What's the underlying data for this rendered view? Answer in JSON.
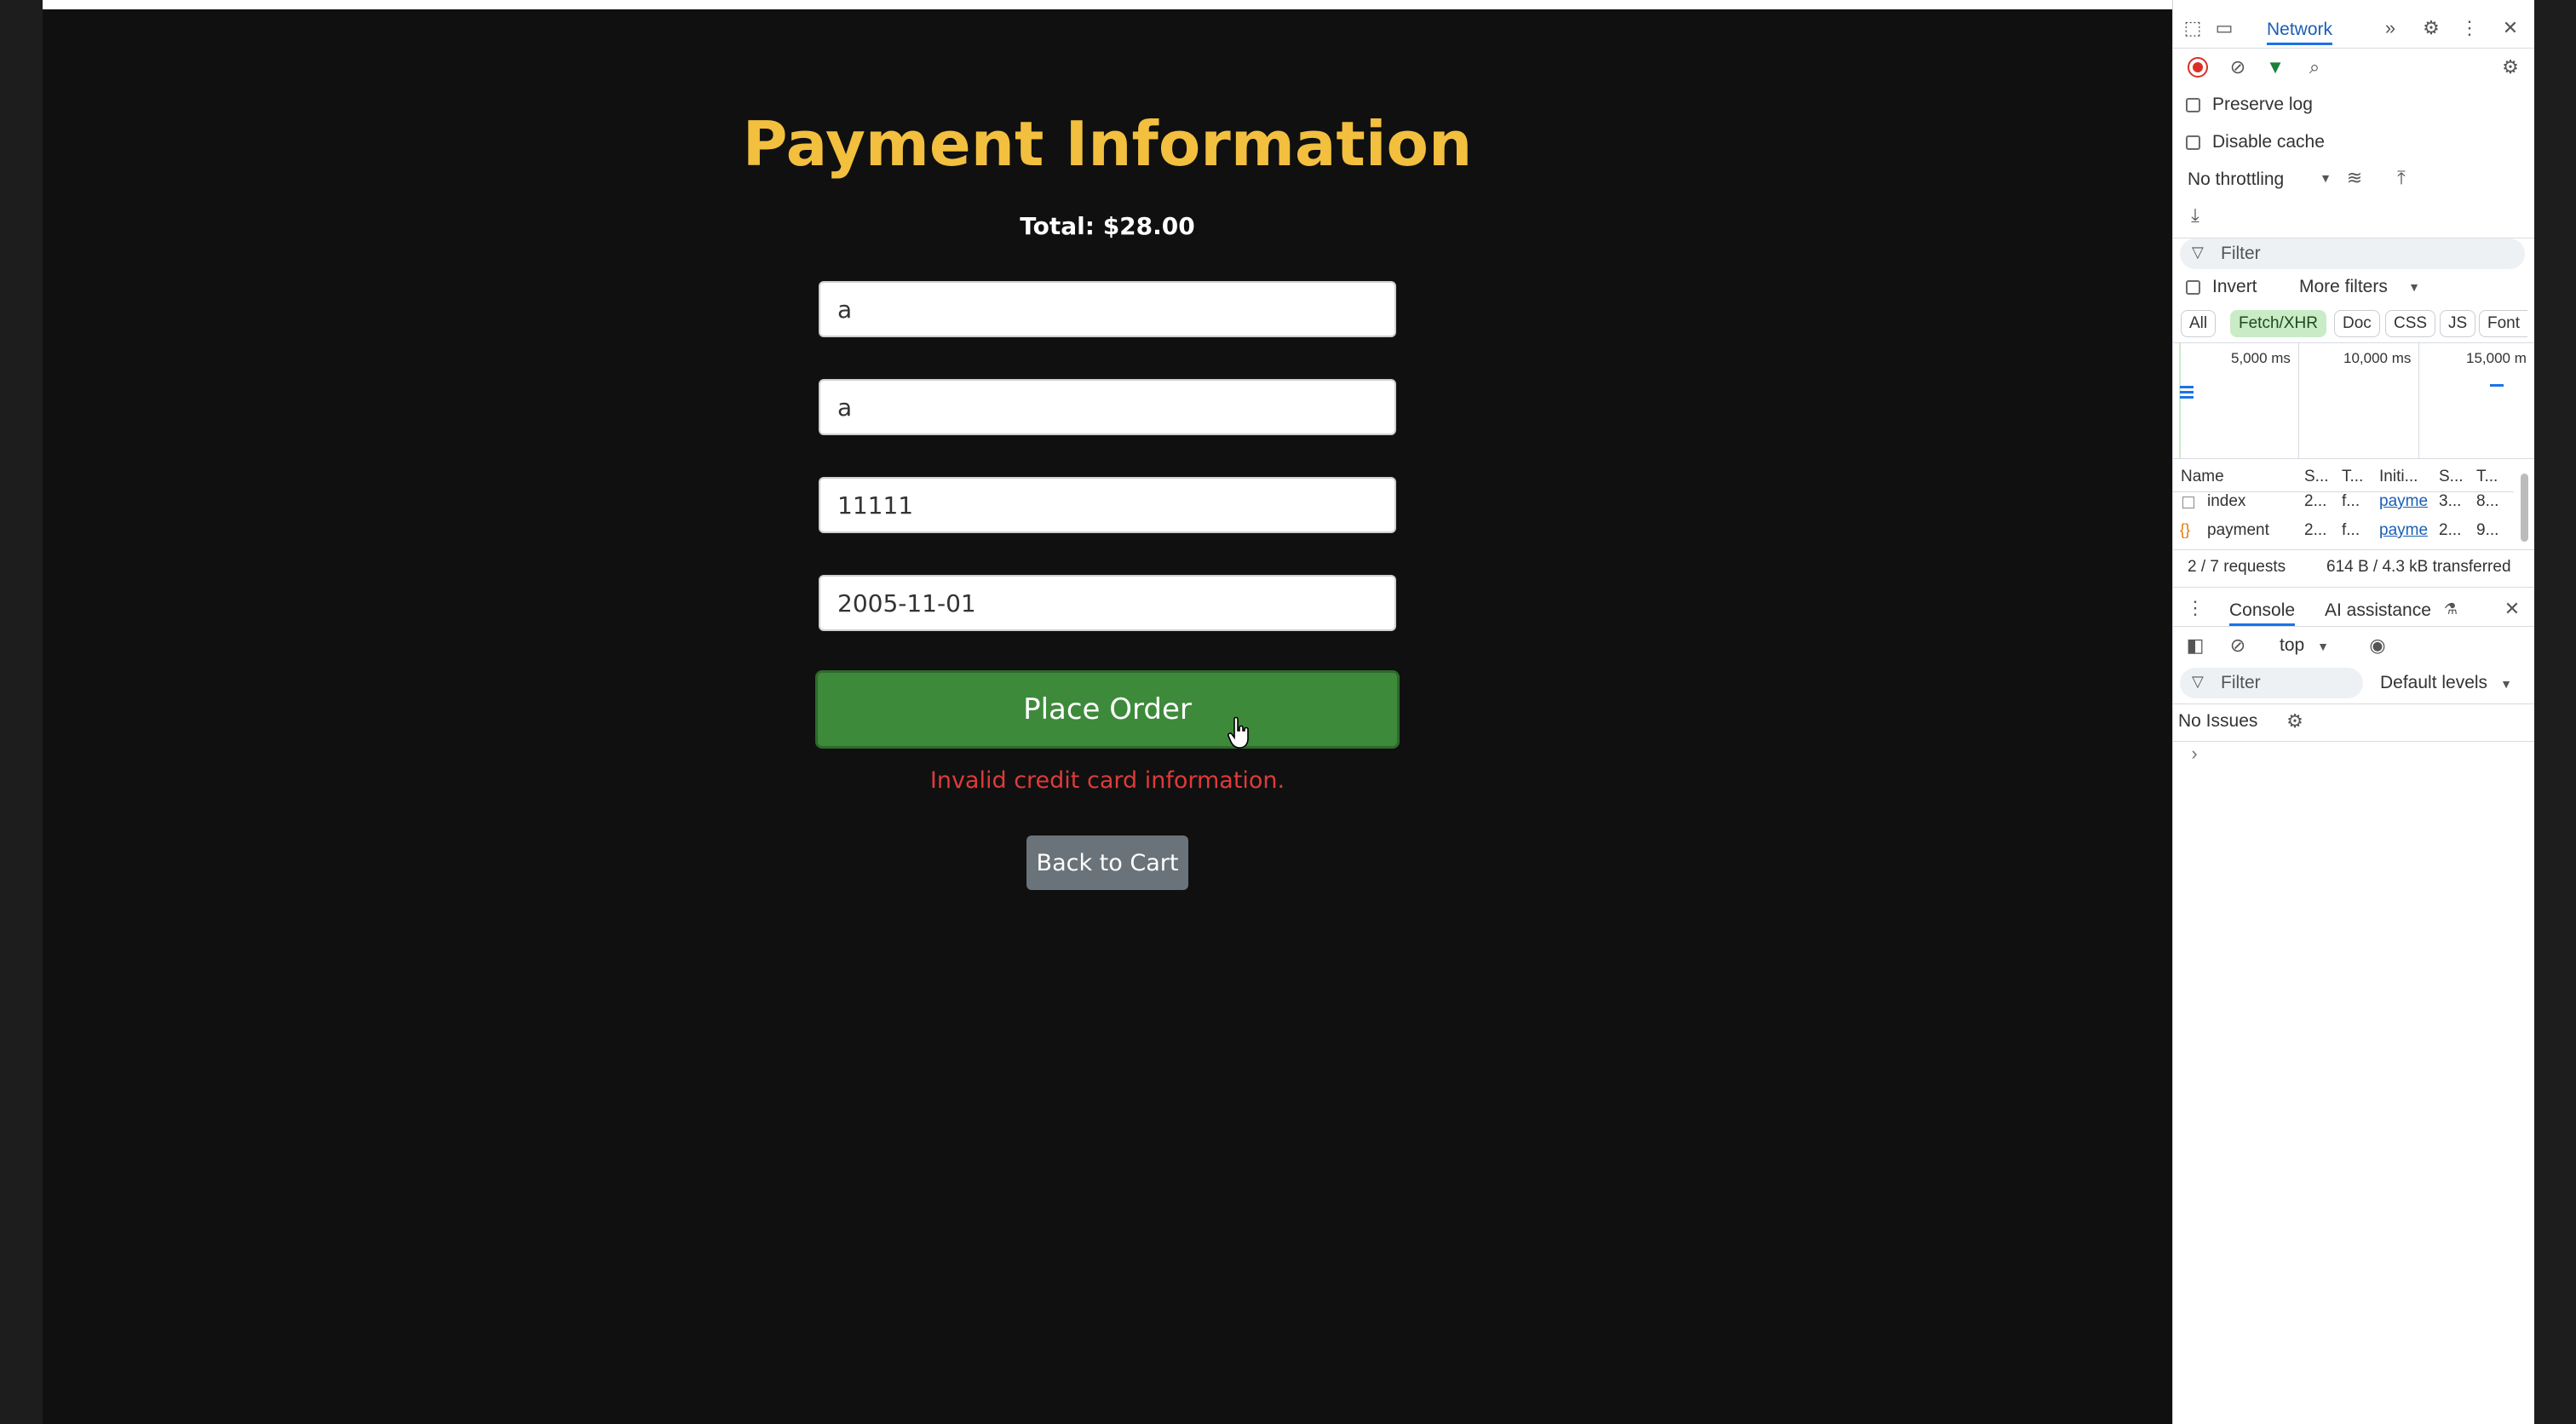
{
  "page": {
    "title": "Payment Information",
    "total": "Total: $28.00",
    "fields": [
      {
        "value": "a"
      },
      {
        "value": "a"
      },
      {
        "value": "11111"
      },
      {
        "value": "2005-11-01"
      }
    ],
    "place_order": "Place Order",
    "error": "Invalid credit card information.",
    "back_to_cart": "Back to Cart",
    "colors": {
      "title": "#f2bf3f",
      "button": "#3d8a3b",
      "error": "#e03a3a"
    }
  },
  "devtools": {
    "active_tab": "Network",
    "preserve_log": "Preserve log",
    "disable_cache": "Disable cache",
    "throttling": "No throttling",
    "filter_placeholder": "Filter",
    "invert": "Invert",
    "more_filters": "More filters",
    "type_filters": [
      "All",
      "Fetch/XHR",
      "Doc",
      "CSS",
      "JS",
      "Font"
    ],
    "timeline_ticks": [
      "5,000 ms",
      "10,000 ms",
      "15,000 m"
    ],
    "columns": [
      "Name",
      "S...",
      "T...",
      "Initi...",
      "S...",
      "T..."
    ],
    "rows": [
      {
        "name": "index",
        "status": "2...",
        "type": "f...",
        "initiator": "payme",
        "size": "3...",
        "time": "8..."
      },
      {
        "name": "payment",
        "status": "2...",
        "type": "f...",
        "initiator": "payme",
        "size": "2...",
        "time": "9..."
      }
    ],
    "summary_requests": "2 / 7 requests",
    "summary_transfer": "614 B / 4.3 kB transferred",
    "console_tab": "Console",
    "ai_tab": "AI assistance",
    "context": "top",
    "console_filter": "Filter",
    "levels": "Default levels",
    "issues": "No Issues"
  }
}
